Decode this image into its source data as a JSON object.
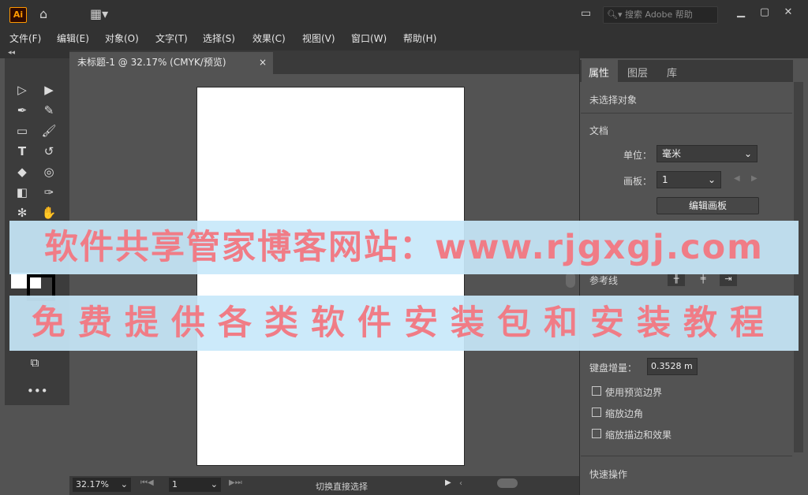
{
  "titlebar": {
    "logo": "Ai",
    "search_placeholder": "搜索 Adobe 帮助",
    "icons": [
      "home-icon",
      "layout-icon",
      "search-icon",
      "minimize-icon",
      "maximize-icon",
      "close-icon"
    ]
  },
  "menu": [
    "文件(F)",
    "编辑(E)",
    "对象(O)",
    "文字(T)",
    "选择(S)",
    "效果(C)",
    "视图(V)",
    "窗口(W)",
    "帮助(H)"
  ],
  "document": {
    "tab_title": "未标题-1 @ 32.17% (CMYK/预览)",
    "close_glyph": "×"
  },
  "status": {
    "zoom": "32.17%",
    "page": "1",
    "text": "切换直接选择"
  },
  "panel": {
    "tabs": [
      "属性",
      "图层",
      "库"
    ],
    "no_selection": "未选择对象",
    "section_document": "文档",
    "unit_label": "单位：",
    "unit_value": "毫米",
    "artboard_label": "画板：",
    "artboard_value": "1",
    "edit_artboard_button": "编辑画板",
    "guides_label": "参考线",
    "keyboard_increment_label": "键盘增量：",
    "keyboard_increment_value": "0.3528 m",
    "checkboxes": [
      "使用预览边界",
      "缩放边角",
      "缩放描边和效果"
    ],
    "quick_actions": "快速操作"
  },
  "watermark": {
    "line1": "软件共享管家博客网站：www.rjgxgj.com",
    "line2": "免费提供各类软件安装包和安装教程"
  },
  "colors": {
    "banner_bg": "#c8e8fa",
    "banner_text": "#f07c86",
    "ai_orange": "#ff9a00"
  }
}
